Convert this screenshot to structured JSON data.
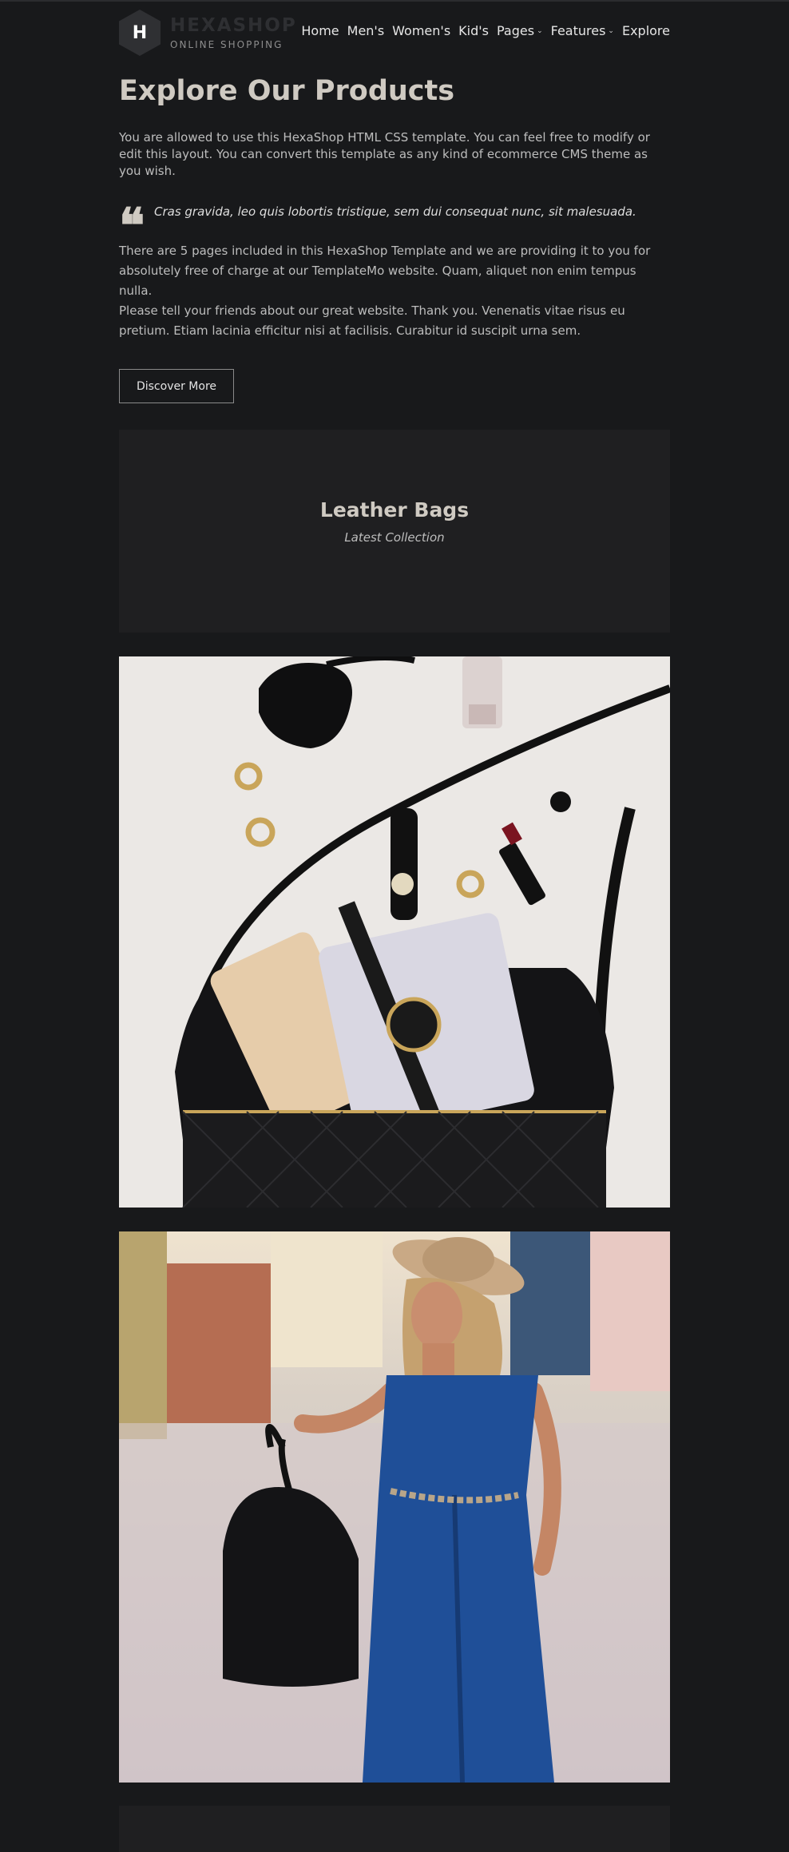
{
  "header": {
    "logo_letter": "H",
    "brand_name": "HEXASHOP",
    "brand_sub": "ONLINE SHOPPING",
    "nav": [
      {
        "label": "Home",
        "has_dropdown": false
      },
      {
        "label": "Men's",
        "has_dropdown": false
      },
      {
        "label": "Women's",
        "has_dropdown": false
      },
      {
        "label": "Kid's",
        "has_dropdown": false
      },
      {
        "label": "Pages",
        "has_dropdown": true
      },
      {
        "label": "Features",
        "has_dropdown": true
      },
      {
        "label": "Explore",
        "has_dropdown": false
      }
    ],
    "chevron": "⌄"
  },
  "main": {
    "title": "Explore Our Products",
    "intro": "You are allowed to use this HexaShop HTML CSS template. You can feel free to modify or edit this layout. You can convert this template as any kind of ecommerce CMS theme as you wish.",
    "quote_glyph": "❝",
    "quote": "Cras gravida, leo quis lobortis tristique, sem dui consequat nunc, sit malesuada.",
    "paragraph2": "There are 5 pages included in this HexaShop Template and we are providing it to you for absolutely free of charge at our TemplateMo website. Quam, aliquet non enim tempus nulla.",
    "paragraph3": "Please tell your friends about our great website. Thank you. Venenatis vitae risus eu pretium. Etiam lacinia efficitur nisi at facilisis. Curabitur id suscipit urna sem.",
    "button_label": "Discover More"
  },
  "feature_card": {
    "title": "Leather Bags",
    "subtitle": "Latest Collection"
  },
  "colors": {
    "background": "#18191b",
    "card": "#1f1f21",
    "heading": "#cfcac2",
    "text": "#bdbdbd"
  },
  "images": [
    {
      "name": "bag-flatlay-photo",
      "subject": "quilted black bag with watch, phone, sunglasses and lipstick"
    },
    {
      "name": "woman-with-bag-photo",
      "subject": "woman in blue jumpsuit holding black bag"
    }
  ]
}
